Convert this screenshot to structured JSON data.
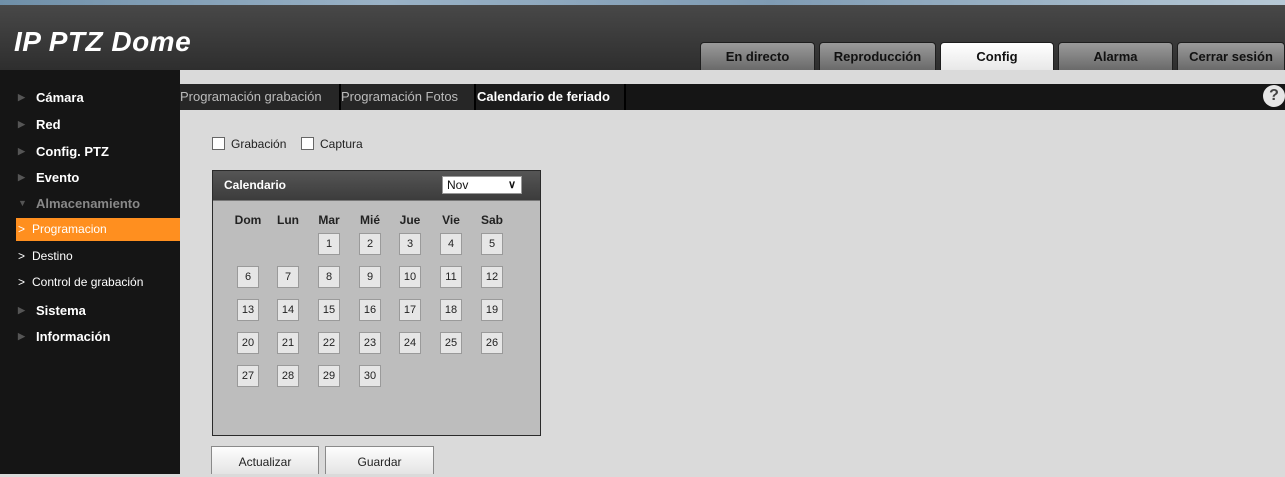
{
  "app": {
    "title": "IP PTZ Dome"
  },
  "nav": {
    "tabs": [
      {
        "label": "En directo",
        "active": false
      },
      {
        "label": "Reproducción",
        "active": false
      },
      {
        "label": "Config",
        "active": true
      },
      {
        "label": "Alarma",
        "active": false
      },
      {
        "label": "Cerrar sesión",
        "active": false
      }
    ]
  },
  "sidebar": {
    "items": [
      {
        "label": "Cámara"
      },
      {
        "label": "Red"
      },
      {
        "label": "Config. PTZ"
      },
      {
        "label": "Evento"
      },
      {
        "label": "Almacenamiento",
        "expanded": true
      },
      {
        "label": "Sistema"
      },
      {
        "label": "Información"
      }
    ],
    "sub_items": [
      {
        "label": "Programacion",
        "active": true
      },
      {
        "label": "Destino",
        "active": false
      },
      {
        "label": "Control de grabación",
        "active": false
      }
    ]
  },
  "subtabs": [
    {
      "label": "Programación grabación",
      "active": false
    },
    {
      "label": "Programación Fotos",
      "active": false
    },
    {
      "label": "Calendario de feriado",
      "active": true
    }
  ],
  "checkboxes": [
    {
      "label": "Grabación",
      "checked": false
    },
    {
      "label": "Captura",
      "checked": false
    }
  ],
  "calendar": {
    "title": "Calendario",
    "month": "Nov",
    "weekdays": [
      "Dom",
      "Lun",
      "Mar",
      "Mié",
      "Jue",
      "Vie",
      "Sab"
    ],
    "weeks": [
      [
        "",
        "",
        "1",
        "2",
        "3",
        "4",
        "5"
      ],
      [
        "6",
        "7",
        "8",
        "9",
        "10",
        "11",
        "12"
      ],
      [
        "13",
        "14",
        "15",
        "16",
        "17",
        "18",
        "19"
      ],
      [
        "20",
        "21",
        "22",
        "23",
        "24",
        "25",
        "26"
      ],
      [
        "27",
        "28",
        "29",
        "30",
        "",
        "",
        ""
      ]
    ]
  },
  "buttons": {
    "refresh": "Actualizar",
    "save": "Guardar"
  },
  "help_icon": "?",
  "colors": {
    "accent": "#ff8f1f",
    "sidebar_bg": "#151515",
    "content_bg": "#dadada"
  }
}
